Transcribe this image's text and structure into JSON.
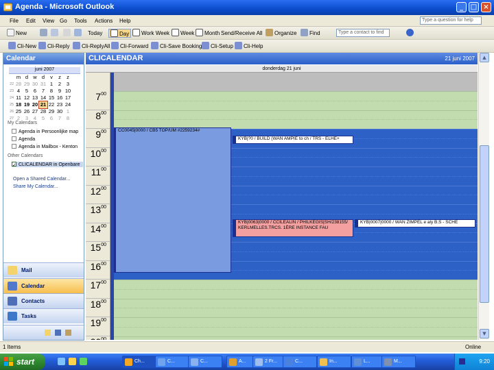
{
  "window": {
    "title": "Agenda - Microsoft Outlook"
  },
  "menu": [
    "File",
    "Edit",
    "View",
    "Go",
    "Tools",
    "Actions",
    "Help"
  ],
  "help_search_placeholder": "Type a question for help",
  "toolbar1": {
    "new": "New",
    "today": "Today",
    "day": "Day",
    "work_week": "Work Week",
    "week": "Week",
    "month": "Month",
    "send_receive": "Send/Receive All",
    "organize": "Organize",
    "find": "Find",
    "find_contact_placeholder": "Type a contact to find"
  },
  "toolbar2": [
    "Cli-New",
    "Cli-Reply",
    "Cli-ReplyAll",
    "Cli-Forward",
    "Cli-Save Booking",
    "Cli-Setup",
    "Cli-Help"
  ],
  "nav": {
    "title": "Calendar",
    "mini_calendar": {
      "month": "juni 2007",
      "weekdays": [
        "m",
        "d",
        "w",
        "d",
        "v",
        "z",
        "z"
      ],
      "weeks": [
        {
          "wk": "22",
          "days": [
            "28",
            "29",
            "30",
            "31",
            "1",
            "2",
            "3"
          ]
        },
        {
          "wk": "23",
          "days": [
            "4",
            "5",
            "6",
            "7",
            "8",
            "9",
            "10"
          ]
        },
        {
          "wk": "24",
          "days": [
            "11",
            "12",
            "13",
            "14",
            "15",
            "16",
            "17"
          ]
        },
        {
          "wk": "25",
          "days": [
            "18",
            "19",
            "20",
            "21",
            "22",
            "23",
            "24"
          ]
        },
        {
          "wk": "26",
          "days": [
            "25",
            "26",
            "27",
            "28",
            "29",
            "30",
            "1"
          ]
        },
        {
          "wk": "27",
          "days": [
            "2",
            "3",
            "4",
            "5",
            "6",
            "7",
            "8"
          ]
        }
      ]
    },
    "my_calendars_label": "My Calendars",
    "my_calendars": [
      "Agenda in Persoonlijke map",
      "Agenda",
      "Agenda in Mailbox - Kenton"
    ],
    "other_calendars_label": "Other Calendars",
    "other_calendars": [
      "CLICALENDAR in Openbare"
    ],
    "links": [
      "Open a Shared Calendar...",
      "Share My Calendar..."
    ],
    "buttons": [
      {
        "label": "Mail",
        "icon": "mail-icon"
      },
      {
        "label": "Calendar",
        "icon": "calendar-icon"
      },
      {
        "label": "Contacts",
        "icon": "contacts-icon"
      },
      {
        "label": "Tasks",
        "icon": "tasks-icon"
      }
    ]
  },
  "calendar": {
    "title": "CLICALENDAR",
    "date": "21 juni 2007",
    "day_header": "donderdag 21 juni",
    "hours": [
      "7",
      "8",
      "9",
      "10",
      "11",
      "12",
      "13",
      "14",
      "15",
      "16",
      "17",
      "18",
      "19",
      "20"
    ],
    "hour_suffix": "00",
    "appointments": [
      {
        "text": "CC0045|0000 / CB5 TOP/UM #2259234#",
        "color": "#7b9be0"
      },
      {
        "text": "KYB|?0 / BUILD (WAN AMPIE to ch / TRS - ELHE+",
        "color": "#ffffff"
      },
      {
        "text": "KYB|0063|0000 / CCILEALIN / PHILKEGIS|SH/238155/ KERLMELLES.TRCS. 1ÈRE INSTANCE FAU",
        "color": "#f4a0a0"
      },
      {
        "text": "KYB|0007|0000 / WAN ZIMPEL e aly B.S - SCHE",
        "color": "#ffffff"
      }
    ]
  },
  "status": {
    "items": "1 Items",
    "online": "Online"
  },
  "taskbar": {
    "start": "start",
    "tasks": [
      "Ch...",
      "C...",
      "C...",
      "A...",
      "2 Fr...",
      "C...",
      "In...",
      "L...",
      "M..."
    ],
    "clock": "9:20"
  },
  "colors": {
    "work_hours": "#2d61c5",
    "non_work": "#c2dcb0",
    "timebar": "#2a45a8"
  }
}
